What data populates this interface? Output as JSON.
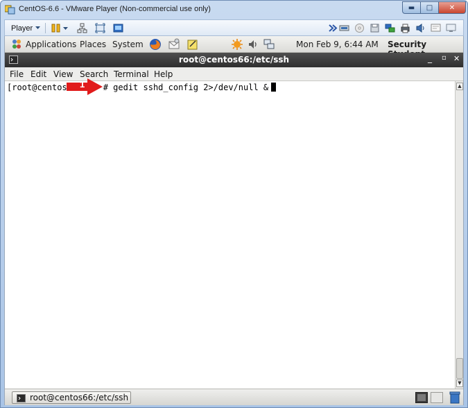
{
  "window": {
    "title": "CentOS-6.6 - VMware Player (Non-commercial use only)",
    "minimize_glyph": "▬",
    "maximize_glyph": "□",
    "close_glyph": "✕"
  },
  "vmware_toolbar": {
    "player_label": "Player",
    "icons": [
      "pause-icon",
      "network-icon",
      "fullscreen-icon",
      "unity-icon",
      "forward-icon",
      "usb-icon",
      "cd-icon",
      "floppy-icon",
      "network-adapter-icon",
      "printer-icon",
      "sound-icon",
      "message-icon",
      "display-icon"
    ]
  },
  "gnome_panel": {
    "applications": "Applications",
    "places": "Places",
    "system": "System",
    "datetime": "Mon Feb  9,  6:44 AM",
    "user": "Security Student"
  },
  "terminal": {
    "title": "root@centos66:/etc/ssh",
    "menu": [
      "File",
      "Edit",
      "View",
      "Search",
      "Terminal",
      "Help"
    ],
    "prompt_prefix": "[root@centos",
    "prompt_suffix": "# gedit sshd_config 2>/dev/null &",
    "controls": {
      "minimize": "_",
      "maximize": "▫",
      "close": "✕"
    }
  },
  "annotation": {
    "number": "1",
    "color": "#e11b1b"
  },
  "taskbar": {
    "item_label": "root@centos66:/etc/ssh"
  }
}
